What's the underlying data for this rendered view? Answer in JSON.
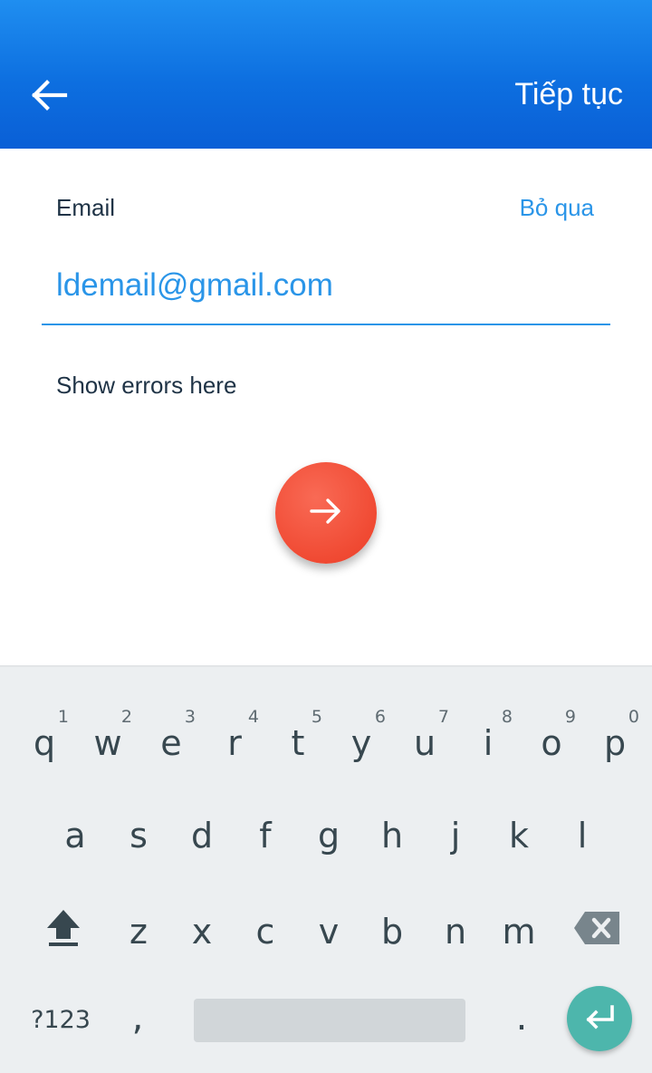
{
  "header": {
    "back_icon": "arrow-left-icon",
    "continue_label": "Tiếp tục"
  },
  "form": {
    "email_label": "Email",
    "skip_label": "Bỏ qua",
    "email_value": "ldemail@gmail.com",
    "error_text": "Show errors here",
    "submit_icon": "arrow-right-icon"
  },
  "keyboard": {
    "row1": [
      {
        "key": "q",
        "hint": "1"
      },
      {
        "key": "w",
        "hint": "2"
      },
      {
        "key": "e",
        "hint": "3"
      },
      {
        "key": "r",
        "hint": "4"
      },
      {
        "key": "t",
        "hint": "5"
      },
      {
        "key": "y",
        "hint": "6"
      },
      {
        "key": "u",
        "hint": "7"
      },
      {
        "key": "i",
        "hint": "8"
      },
      {
        "key": "o",
        "hint": "9"
      },
      {
        "key": "p",
        "hint": "0"
      }
    ],
    "row2": [
      "a",
      "s",
      "d",
      "f",
      "g",
      "h",
      "j",
      "k",
      "l"
    ],
    "row3": [
      "z",
      "x",
      "c",
      "v",
      "b",
      "n",
      "m"
    ],
    "symbols_label": "?123",
    "comma": ",",
    "period": ".",
    "shift_icon": "shift-icon",
    "backspace_icon": "backspace-icon",
    "enter_icon": "enter-icon"
  },
  "colors": {
    "header_gradient_top": "#1f8ef0",
    "header_gradient_bottom": "#0a5fd6",
    "accent": "#2a95e8",
    "fab": "#f04a33",
    "enter_key": "#4db6ac",
    "keyboard_bg": "#eceff1"
  }
}
